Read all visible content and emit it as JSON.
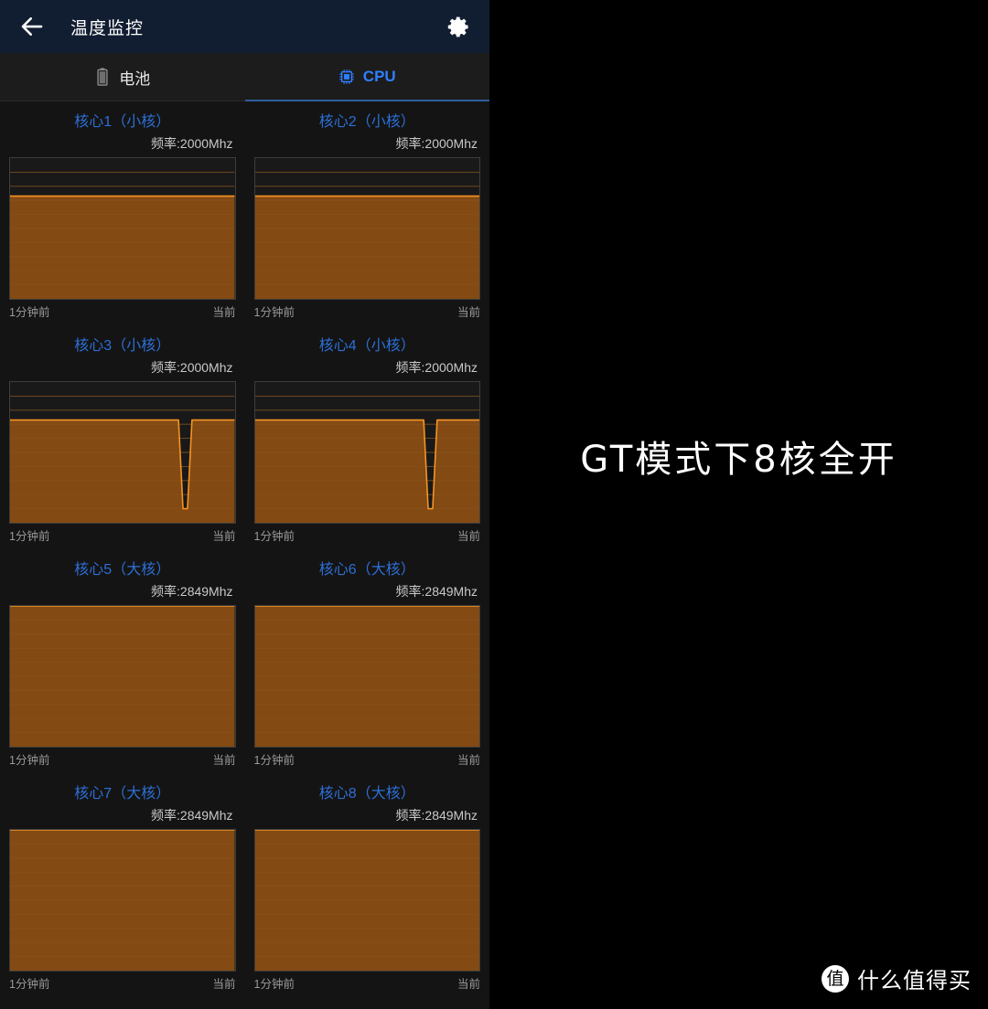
{
  "appbar": {
    "title": "温度监控",
    "back_icon": "arrow-left-icon",
    "settings_icon": "gear-icon",
    "bg_color": "#111d31"
  },
  "tabs": [
    {
      "label": "电池",
      "icon": "battery-icon",
      "active": false
    },
    {
      "label": "CPU",
      "icon": "cpu-chip-icon",
      "active": true
    }
  ],
  "axis": {
    "left_label": "1分钟前",
    "right_label": "当前"
  },
  "colors": {
    "accent_blue": "#2e7fff",
    "title_blue": "#2d6fd6",
    "line_orange": "#f59324",
    "fill_orange": "#834a13",
    "grid": "#8a5a23",
    "empty_bg": "#191919",
    "panel_bg": "#141414"
  },
  "chart_data": [
    {
      "type": "area",
      "title": "核心1（小核）",
      "freq_label": "频率:2000Mhz",
      "freq_mhz": 2000,
      "core_type": "小核",
      "core_index": 1,
      "xlabel": "",
      "ylabel": "",
      "xlim": [
        0,
        100
      ],
      "ylim": [
        0,
        100
      ],
      "grid": true,
      "x": [
        0,
        100
      ],
      "values": [
        73,
        73
      ],
      "xtick_labels": [
        "1分钟前",
        "当前"
      ]
    },
    {
      "type": "area",
      "title": "核心2（小核）",
      "freq_label": "频率:2000Mhz",
      "freq_mhz": 2000,
      "core_type": "小核",
      "core_index": 2,
      "xlabel": "",
      "ylabel": "",
      "xlim": [
        0,
        100
      ],
      "ylim": [
        0,
        100
      ],
      "grid": true,
      "x": [
        0,
        100
      ],
      "values": [
        73,
        73
      ],
      "xtick_labels": [
        "1分钟前",
        "当前"
      ]
    },
    {
      "type": "area",
      "title": "核心3（小核）",
      "freq_label": "频率:2000Mhz",
      "freq_mhz": 2000,
      "core_type": "小核",
      "core_index": 3,
      "xlabel": "",
      "ylabel": "",
      "xlim": [
        0,
        100
      ],
      "ylim": [
        0,
        100
      ],
      "grid": true,
      "x": [
        0,
        75,
        77,
        79,
        81,
        100
      ],
      "values": [
        73,
        73,
        10,
        10,
        73,
        73
      ],
      "xtick_labels": [
        "1分钟前",
        "当前"
      ]
    },
    {
      "type": "area",
      "title": "核心4（小核）",
      "freq_label": "频率:2000Mhz",
      "freq_mhz": 2000,
      "core_type": "小核",
      "core_index": 4,
      "xlabel": "",
      "ylabel": "",
      "xlim": [
        0,
        100
      ],
      "ylim": [
        0,
        100
      ],
      "grid": true,
      "x": [
        0,
        75,
        77,
        79,
        81,
        100
      ],
      "values": [
        73,
        73,
        10,
        10,
        73,
        73
      ],
      "xtick_labels": [
        "1分钟前",
        "当前"
      ]
    },
    {
      "type": "area",
      "title": "核心5（大核）",
      "freq_label": "频率:2849Mhz",
      "freq_mhz": 2849,
      "core_type": "大核",
      "core_index": 5,
      "xlabel": "",
      "ylabel": "",
      "xlim": [
        0,
        100
      ],
      "ylim": [
        0,
        100
      ],
      "grid": true,
      "x": [
        0,
        100
      ],
      "values": [
        100,
        100
      ],
      "xtick_labels": [
        "1分钟前",
        "当前"
      ]
    },
    {
      "type": "area",
      "title": "核心6（大核）",
      "freq_label": "频率:2849Mhz",
      "freq_mhz": 2849,
      "core_type": "大核",
      "core_index": 6,
      "xlabel": "",
      "ylabel": "",
      "xlim": [
        0,
        100
      ],
      "ylim": [
        0,
        100
      ],
      "grid": true,
      "x": [
        0,
        100
      ],
      "values": [
        100,
        100
      ],
      "xtick_labels": [
        "1分钟前",
        "当前"
      ]
    },
    {
      "type": "area",
      "title": "核心7（大核）",
      "freq_label": "频率:2849Mhz",
      "freq_mhz": 2849,
      "core_type": "大核",
      "core_index": 7,
      "xlabel": "",
      "ylabel": "",
      "xlim": [
        0,
        100
      ],
      "ylim": [
        0,
        100
      ],
      "grid": true,
      "x": [
        0,
        100
      ],
      "values": [
        100,
        100
      ],
      "xtick_labels": [
        "1分钟前",
        "当前"
      ]
    },
    {
      "type": "area",
      "title": "核心8（大核）",
      "freq_label": "频率:2849Mhz",
      "freq_mhz": 2849,
      "core_type": "大核",
      "core_index": 8,
      "xlabel": "",
      "ylabel": "",
      "xlim": [
        0,
        100
      ],
      "ylim": [
        0,
        100
      ],
      "grid": true,
      "x": [
        0,
        100
      ],
      "values": [
        100,
        100
      ],
      "xtick_labels": [
        "1分钟前",
        "当前"
      ]
    }
  ],
  "annotation": {
    "caption": "GT模式下8核全开"
  },
  "watermark": {
    "logo_glyph": "值",
    "text": "什么值得买"
  }
}
